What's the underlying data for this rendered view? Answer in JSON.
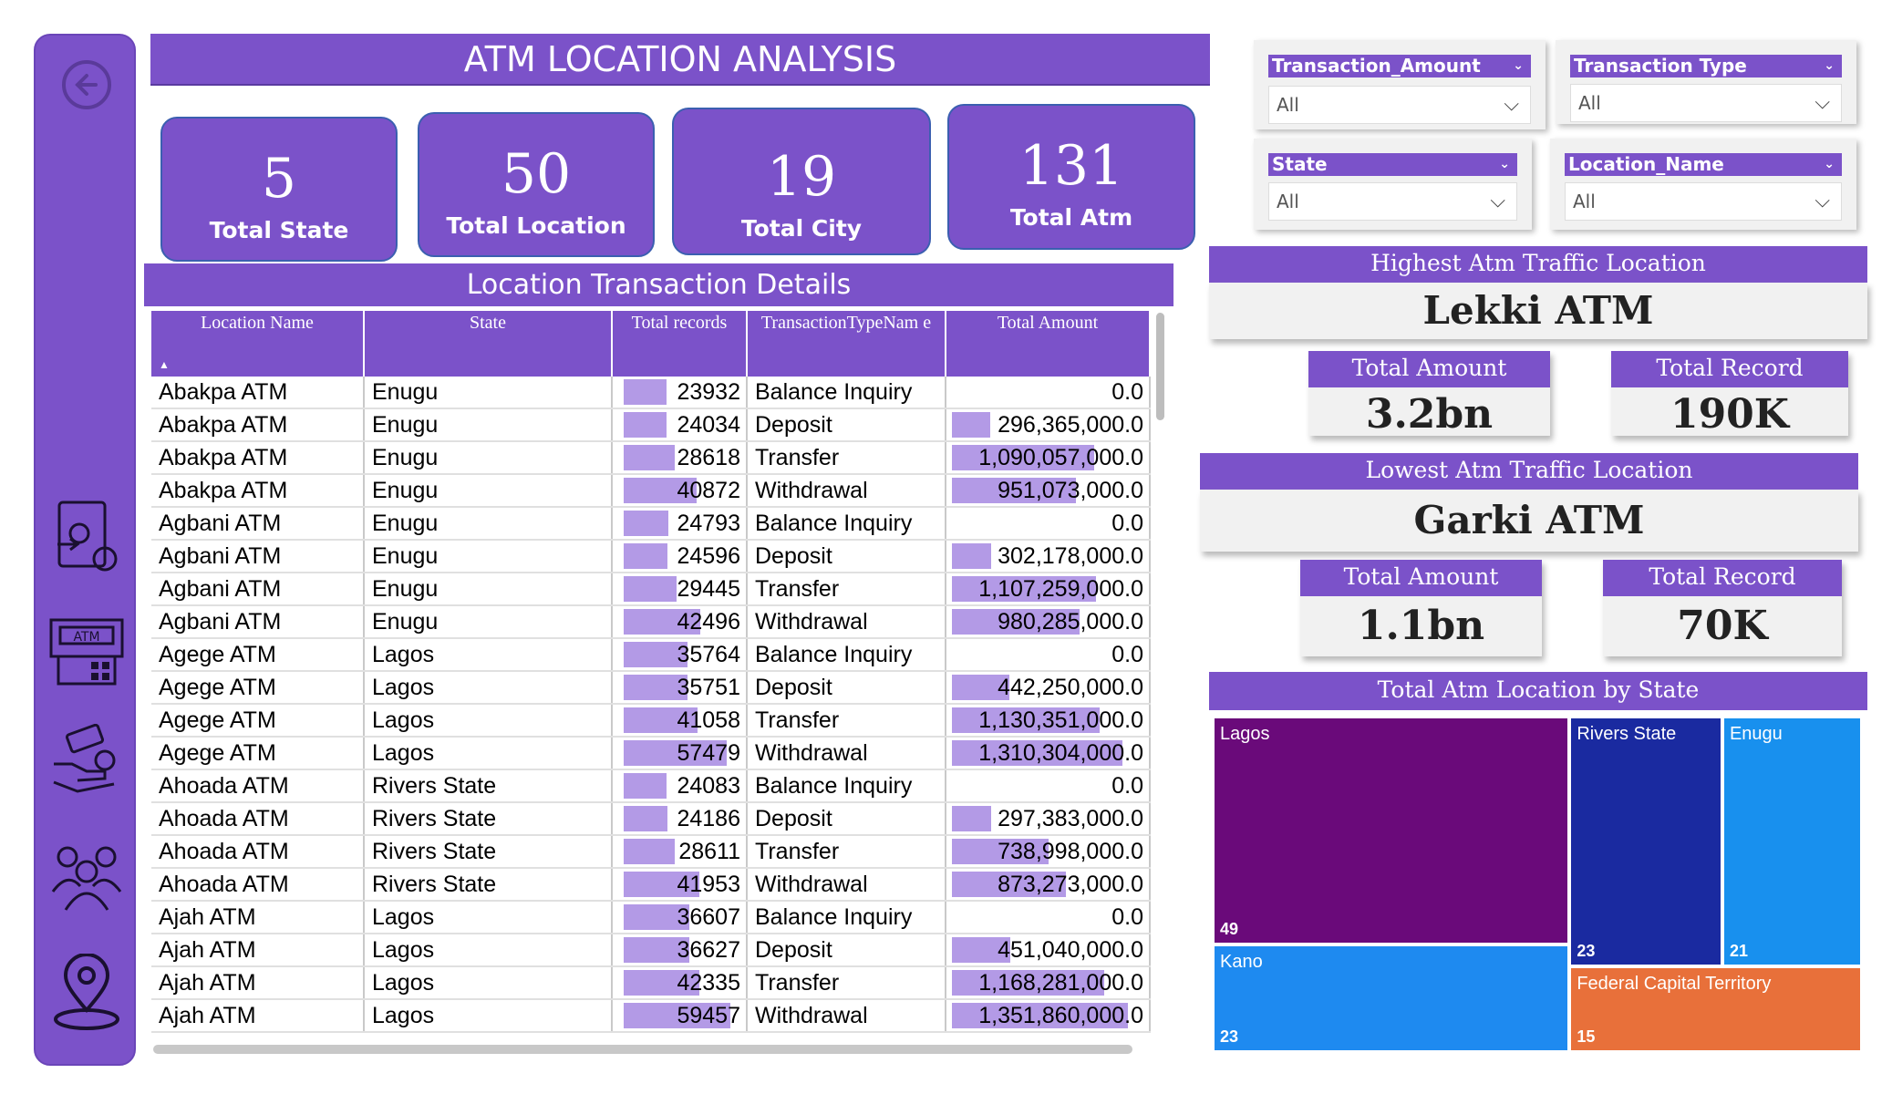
{
  "header": {
    "title": "ATM LOCATION ANALYSIS"
  },
  "kpis": [
    {
      "value": "5",
      "label": "Total State"
    },
    {
      "value": "50",
      "label": "Total Location"
    },
    {
      "value": "19",
      "label": "Total City"
    },
    {
      "value": "131",
      "label": "Total Atm"
    }
  ],
  "table": {
    "title": "Location Transaction Details",
    "columns": [
      "Location Name",
      "State",
      "Total records",
      "TransactionTypeNam e",
      "Total Amount"
    ],
    "max_records": 60000,
    "max_amount": 1400000000,
    "rows": [
      {
        "loc": "Abakpa ATM",
        "state": "Enugu",
        "records": "23932",
        "r": 23932,
        "type": "Balance Inquiry",
        "amount": "0.0",
        "a": 0
      },
      {
        "loc": "Abakpa ATM",
        "state": "Enugu",
        "records": "24034",
        "r": 24034,
        "type": "Deposit",
        "amount": "296,365,000.0",
        "a": 296365000
      },
      {
        "loc": "Abakpa ATM",
        "state": "Enugu",
        "records": "28618",
        "r": 28618,
        "type": "Transfer",
        "amount": "1,090,057,000.0",
        "a": 1090057000
      },
      {
        "loc": "Abakpa ATM",
        "state": "Enugu",
        "records": "40872",
        "r": 40872,
        "type": "Withdrawal",
        "amount": "951,073,000.0",
        "a": 951073000
      },
      {
        "loc": "Agbani ATM",
        "state": "Enugu",
        "records": "24793",
        "r": 24793,
        "type": "Balance Inquiry",
        "amount": "0.0",
        "a": 0
      },
      {
        "loc": "Agbani ATM",
        "state": "Enugu",
        "records": "24596",
        "r": 24596,
        "type": "Deposit",
        "amount": "302,178,000.0",
        "a": 302178000
      },
      {
        "loc": "Agbani ATM",
        "state": "Enugu",
        "records": "29445",
        "r": 29445,
        "type": "Transfer",
        "amount": "1,107,259,000.0",
        "a": 1107259000
      },
      {
        "loc": "Agbani ATM",
        "state": "Enugu",
        "records": "42496",
        "r": 42496,
        "type": "Withdrawal",
        "amount": "980,285,000.0",
        "a": 980285000
      },
      {
        "loc": "Agege ATM",
        "state": "Lagos",
        "records": "35764",
        "r": 35764,
        "type": "Balance Inquiry",
        "amount": "0.0",
        "a": 0
      },
      {
        "loc": "Agege ATM",
        "state": "Lagos",
        "records": "35751",
        "r": 35751,
        "type": "Deposit",
        "amount": "442,250,000.0",
        "a": 442250000
      },
      {
        "loc": "Agege ATM",
        "state": "Lagos",
        "records": "41058",
        "r": 41058,
        "type": "Transfer",
        "amount": "1,130,351,000.0",
        "a": 1130351000
      },
      {
        "loc": "Agege ATM",
        "state": "Lagos",
        "records": "57479",
        "r": 57479,
        "type": "Withdrawal",
        "amount": "1,310,304,000.0",
        "a": 1310304000
      },
      {
        "loc": "Ahoada ATM",
        "state": "Rivers State",
        "records": "24083",
        "r": 24083,
        "type": "Balance Inquiry",
        "amount": "0.0",
        "a": 0
      },
      {
        "loc": "Ahoada ATM",
        "state": "Rivers State",
        "records": "24186",
        "r": 24186,
        "type": "Deposit",
        "amount": "297,383,000.0",
        "a": 297383000
      },
      {
        "loc": "Ahoada ATM",
        "state": "Rivers State",
        "records": "28611",
        "r": 28611,
        "type": "Transfer",
        "amount": "738,998,000.0",
        "a": 738998000
      },
      {
        "loc": "Ahoada ATM",
        "state": "Rivers State",
        "records": "41953",
        "r": 41953,
        "type": "Withdrawal",
        "amount": "873,273,000.0",
        "a": 873273000
      },
      {
        "loc": "Ajah ATM",
        "state": "Lagos",
        "records": "36607",
        "r": 36607,
        "type": "Balance Inquiry",
        "amount": "0.0",
        "a": 0
      },
      {
        "loc": "Ajah ATM",
        "state": "Lagos",
        "records": "36627",
        "r": 36627,
        "type": "Deposit",
        "amount": "451,040,000.0",
        "a": 451040000
      },
      {
        "loc": "Ajah ATM",
        "state": "Lagos",
        "records": "42335",
        "r": 42335,
        "type": "Transfer",
        "amount": "1,168,281,000.0",
        "a": 1168281000
      },
      {
        "loc": "Ajah ATM",
        "state": "Lagos",
        "records": "59457",
        "r": 59457,
        "type": "Withdrawal",
        "amount": "1,351,860,000.0",
        "a": 1351860000
      }
    ]
  },
  "filters": [
    {
      "label": "Transaction_Amount",
      "value": "All"
    },
    {
      "label": "Transaction Type",
      "value": "All"
    },
    {
      "label": "State",
      "value": "All"
    },
    {
      "label": "Location_Name",
      "value": "All"
    }
  ],
  "highest": {
    "title": "Highest Atm Traffic Location",
    "name": "Lekki ATM",
    "amount_label": "Total Amount",
    "amount": "3.2bn",
    "record_label": "Total Record",
    "record": "190K"
  },
  "lowest": {
    "title": "Lowest Atm Traffic Location",
    "name": "Garki ATM",
    "amount_label": "Total Amount",
    "amount": "1.1bn",
    "record_label": "Total Record",
    "record": "70K"
  },
  "chart_data": {
    "type": "treemap",
    "title": "Total Atm Location by State",
    "categories": [
      "Lagos",
      "Rivers State",
      "Enugu",
      "Kano",
      "Federal Capital Territory"
    ],
    "values": [
      49,
      23,
      21,
      23,
      15
    ],
    "colors": [
      "#6a0a7a",
      "#1a2aa0",
      "#1890ee",
      "#1e8af0",
      "#e8703a"
    ]
  },
  "colors": {
    "accent": "#7b52c9",
    "bar": "#b39ae6"
  }
}
